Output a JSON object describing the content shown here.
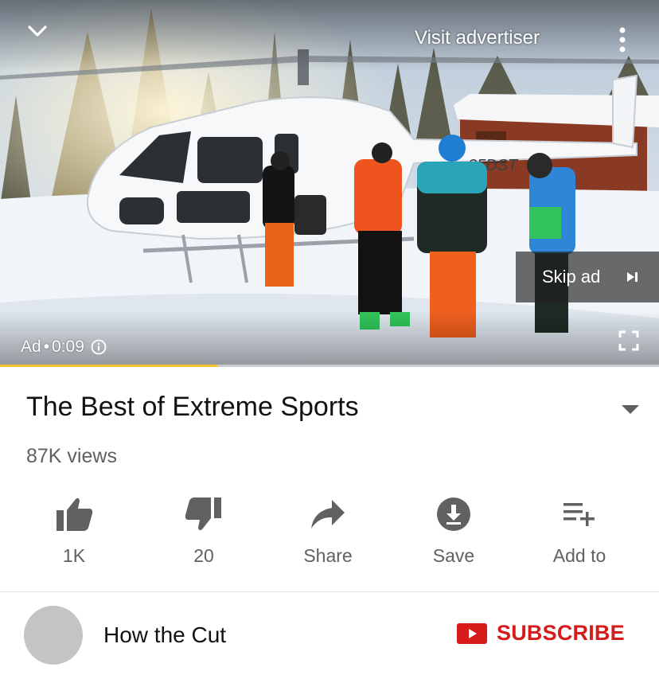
{
  "player": {
    "visit_advertiser": "Visit advertiser",
    "skip_ad": "Skip ad",
    "ad_label": "Ad",
    "ad_separator": "•",
    "ad_time": "0:09",
    "progress_fraction": 0.33,
    "progress_color": "#f3c12b",
    "aircraft_registration": "35DST"
  },
  "video": {
    "title": "The Best of Extreme Sports",
    "views": "87K views"
  },
  "actions": [
    {
      "id": "like",
      "label": "1K",
      "icon": "thumbs-up-icon"
    },
    {
      "id": "dislike",
      "label": "20",
      "icon": "thumbs-down-icon"
    },
    {
      "id": "share",
      "label": "Share",
      "icon": "share-arrow-icon"
    },
    {
      "id": "save",
      "label": "Save",
      "icon": "download-icon"
    },
    {
      "id": "add_to",
      "label": "Add to",
      "icon": "playlist-add-icon"
    }
  ],
  "channel": {
    "name": "How the Cut",
    "subscribe_label": "SUBSCRIBE",
    "subscribe_color": "#d61b1b"
  }
}
